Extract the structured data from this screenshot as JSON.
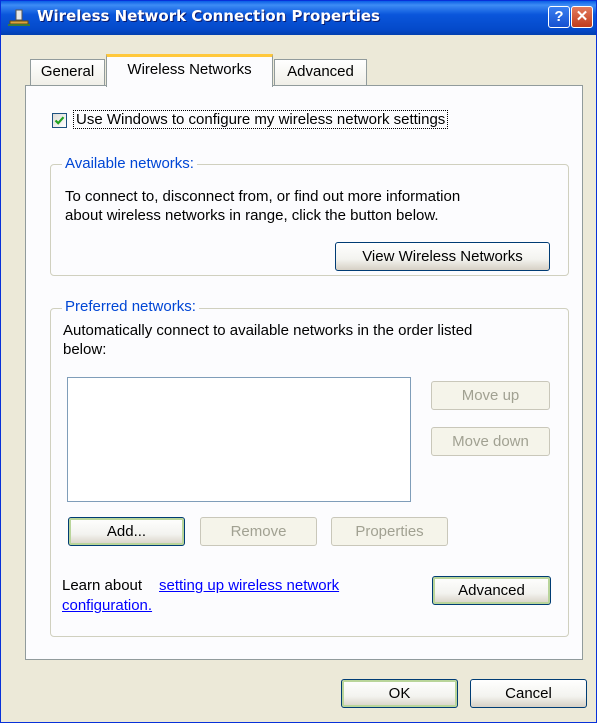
{
  "window": {
    "title": "Wireless Network Connection Properties",
    "help_label": "?",
    "close_label": "✕"
  },
  "tabs": [
    {
      "label": "General"
    },
    {
      "label": "Wireless Networks"
    },
    {
      "label": "Advanced"
    }
  ],
  "use_windows": {
    "label": "Use Windows to configure my wireless network settings",
    "checked": true
  },
  "available": {
    "legend": "Available networks:",
    "line1": "To connect to, disconnect from, or find out more information",
    "line2": "about wireless networks in range, click the button below.",
    "view_button": "View Wireless Networks"
  },
  "preferred": {
    "legend": "Preferred networks:",
    "line1": "Automatically connect to available networks in the order listed",
    "line2": "below:",
    "move_up": "Move up",
    "move_down": "Move down",
    "add": "Add...",
    "remove": "Remove",
    "properties": "Properties",
    "learn_prefix": "Learn about",
    "link_line1": "setting up wireless network",
    "link_line2": "configuration.",
    "advanced": "Advanced"
  },
  "footer": {
    "ok": "OK",
    "cancel": "Cancel"
  }
}
